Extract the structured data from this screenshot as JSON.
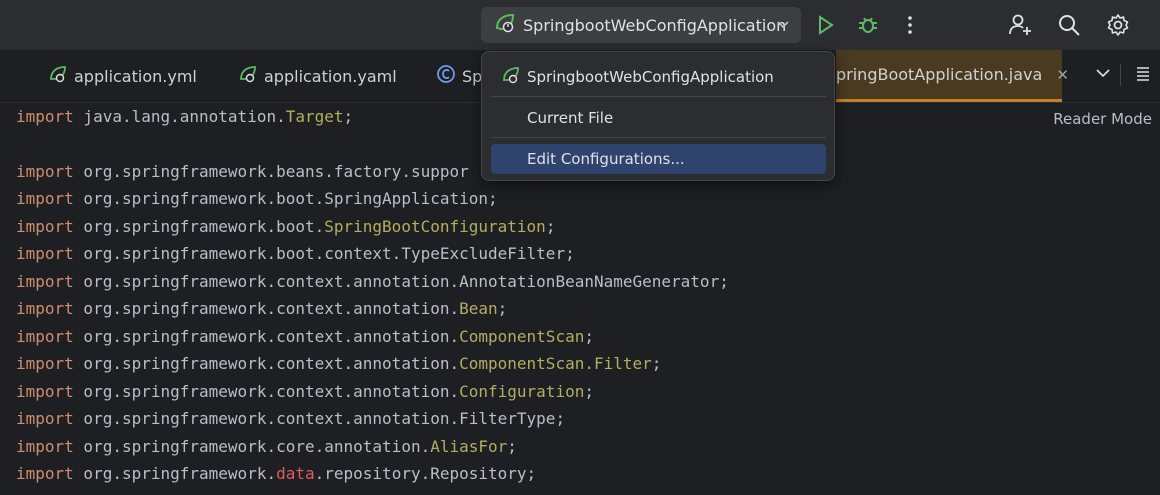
{
  "toolbar": {
    "run_config_label": "SpringbootWebConfigApplication",
    "icons": [
      "spring-leaf-icon",
      "chevron-down-icon",
      "run-icon",
      "debug-icon",
      "more-vertical-icon",
      "add-user-icon",
      "search-icon",
      "gear-icon"
    ]
  },
  "tabs": [
    {
      "label": "application.yml"
    },
    {
      "label": "application.yaml"
    },
    {
      "label": "Sp"
    },
    {
      "label": "pringBootApplication.java",
      "active": true
    }
  ],
  "dropdown": {
    "items": [
      {
        "label": "SpringbootWebConfigApplication"
      },
      {
        "label": "Current File"
      },
      {
        "label": "Edit Configurations...",
        "selected": true
      }
    ]
  },
  "editor": {
    "reader_mode": "Reader Mode",
    "lines": [
      [
        [
          "kw",
          "import"
        ],
        [
          "p",
          " java.lang.annotation."
        ],
        [
          "ann",
          "Target"
        ],
        [
          "p",
          ";"
        ]
      ],
      [],
      [
        [
          "kw",
          "import"
        ],
        [
          "p",
          " org.springframework.beans.factory.suppor"
        ]
      ],
      [
        [
          "kw",
          "import"
        ],
        [
          "p",
          " org.springframework.boot.SpringApplication;"
        ]
      ],
      [
        [
          "kw",
          "import"
        ],
        [
          "p",
          " org.springframework.boot."
        ],
        [
          "ann",
          "SpringBootConfiguration"
        ],
        [
          "p",
          ";"
        ]
      ],
      [
        [
          "kw",
          "import"
        ],
        [
          "p",
          " org.springframework.boot.context.TypeExcludeFilter;"
        ]
      ],
      [
        [
          "kw",
          "import"
        ],
        [
          "p",
          " org.springframework.context.annotation.AnnotationBeanNameGenerator;"
        ]
      ],
      [
        [
          "kw",
          "import"
        ],
        [
          "p",
          " org.springframework.context.annotation."
        ],
        [
          "ann",
          "Bean"
        ],
        [
          "p",
          ";"
        ]
      ],
      [
        [
          "kw",
          "import"
        ],
        [
          "p",
          " org.springframework.context.annotation."
        ],
        [
          "ann",
          "ComponentScan"
        ],
        [
          "p",
          ";"
        ]
      ],
      [
        [
          "kw",
          "import"
        ],
        [
          "p",
          " org.springframework.context.annotation."
        ],
        [
          "ann",
          "ComponentScan.Filter"
        ],
        [
          "p",
          ";"
        ]
      ],
      [
        [
          "kw",
          "import"
        ],
        [
          "p",
          " org.springframework.context.annotation."
        ],
        [
          "ann",
          "Configuration"
        ],
        [
          "p",
          ";"
        ]
      ],
      [
        [
          "kw",
          "import"
        ],
        [
          "p",
          " org.springframework.context.annotation.FilterType;"
        ]
      ],
      [
        [
          "kw",
          "import"
        ],
        [
          "p",
          " org.springframework.core.annotation."
        ],
        [
          "ann",
          "AliasFor"
        ],
        [
          "p",
          ";"
        ]
      ],
      [
        [
          "kw",
          "import"
        ],
        [
          "p",
          " org.springframework."
        ],
        [
          "red",
          "data"
        ],
        [
          "p",
          ".repository.Repository;"
        ]
      ]
    ]
  },
  "colors": {
    "keyword": "#cf8e6d",
    "annotation": "#b3ae60",
    "accent_tab": "#c47f2d",
    "selection": "#2e436e",
    "run": "#5fb865"
  }
}
